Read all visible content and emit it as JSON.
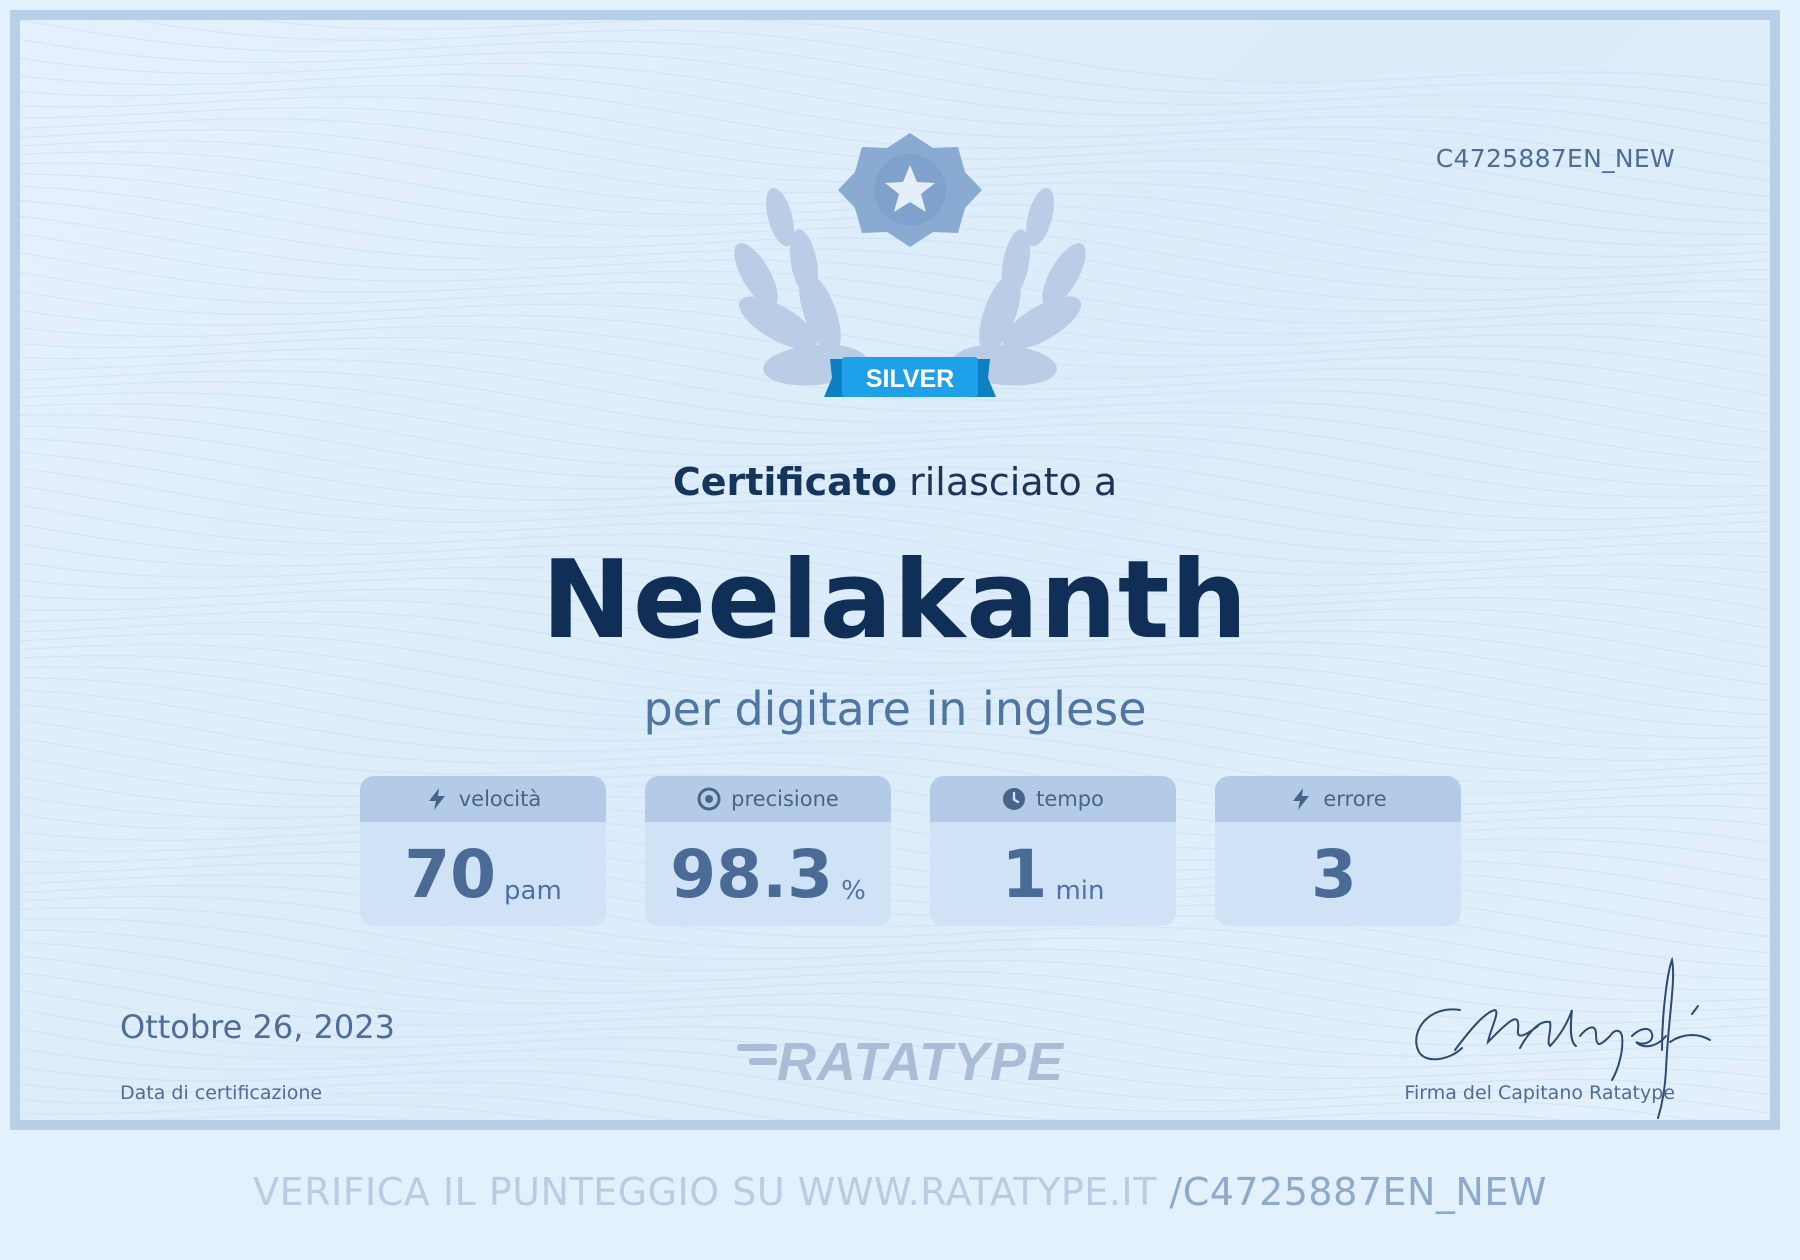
{
  "certificate": {
    "id": "C4725887EN_NEW",
    "level_badge": "SILVER",
    "issued_strong": "Certificato",
    "issued_rest": " rilasciato a",
    "recipient": "Neelakanth",
    "subtitle": "per digitare in inglese"
  },
  "stats": [
    {
      "label": "velocità",
      "value": "70",
      "unit": "pam",
      "icon": "lightning-icon"
    },
    {
      "label": "precisione",
      "value": "98.3",
      "unit": "%",
      "icon": "target-icon"
    },
    {
      "label": "tempo",
      "value": "1",
      "unit": "min",
      "icon": "clock-icon"
    },
    {
      "label": "errore",
      "value": "3",
      "unit": "",
      "icon": "lightning-icon"
    }
  ],
  "footer": {
    "date": "Ottobre 26, 2023",
    "date_label": "Data di certificazione",
    "logo_text": "RATATYPE",
    "signature_label": "Firma del Capitano Ratatype"
  },
  "verify": {
    "prefix": "VERIFICA IL PUNTEGGIO SU WWW.RATATYPE.IT ",
    "code": "/C4725887EN_NEW"
  },
  "colors": {
    "badge": "#1ea1e8",
    "laurel": "#b9cde6",
    "medal": "#89abd2",
    "title": "#0f2f56"
  }
}
